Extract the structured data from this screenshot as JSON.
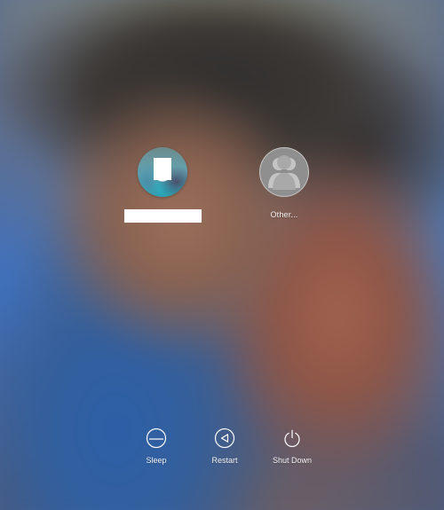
{
  "users": [
    {
      "display_name": "",
      "avatar": "user-photo",
      "name_hidden": true
    },
    {
      "display_name": "Other...",
      "avatar": "generic-users-icon"
    }
  ],
  "actions": {
    "sleep": {
      "label": "Sleep",
      "icon": "sleep-icon"
    },
    "restart": {
      "label": "Restart",
      "icon": "restart-icon"
    },
    "shutdown": {
      "label": "Shut Down",
      "icon": "power-icon"
    }
  },
  "colors": {
    "text": "#f4f4f4",
    "icon_stroke": "#ffffff",
    "generic_avatar_bg": "#8f8f8f",
    "wallpaper_blue": "#3d74c6",
    "wallpaper_skin": "#9b715c"
  }
}
